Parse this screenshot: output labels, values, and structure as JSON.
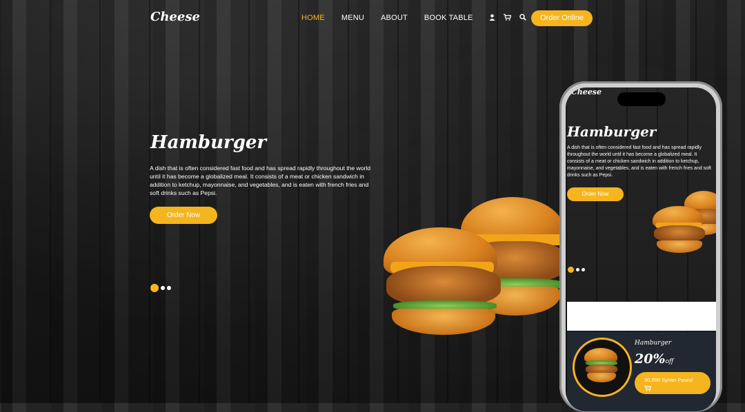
{
  "brand": {
    "logo": "Cheese",
    "accent": "#f5b51f"
  },
  "nav": {
    "items": [
      {
        "label": "HOME",
        "active": true
      },
      {
        "label": "MENU",
        "active": false
      },
      {
        "label": "ABOUT",
        "active": false
      },
      {
        "label": "BOOK TABLE",
        "active": false
      }
    ],
    "icons": [
      "user-icon",
      "cart-icon",
      "search-icon"
    ],
    "order_button": "Order Online"
  },
  "hero": {
    "title": "Hamburger",
    "description": "A dish that is often considered fast food and has spread rapidly throughout the world until it has become a globalized meal. It consists of a meat or chicken sandwich in addition to ketchup, mayonnaise, and vegetables, and is eaten with french fries and soft drinks such as Pepsi.",
    "button": "Order Now",
    "slides": 3,
    "active_slide": 1
  },
  "phone": {
    "logo": "Cheese",
    "title": "Hamburger",
    "description": "A dish that is often considered fast food and has spread rapidly throughout the world until it has become a globalized meal. It consists of a meat or chicken sandwich in addition to ketchup, mayonnaise, and vegetables, and is eaten with french fries and soft drinks such as Pepsi.",
    "button": "Order Now",
    "card": {
      "title": "Hamburger",
      "discount": "20%",
      "off_label": "off",
      "price": "30,000 Syrian Pound",
      "cart_icon": "cart-icon"
    }
  }
}
